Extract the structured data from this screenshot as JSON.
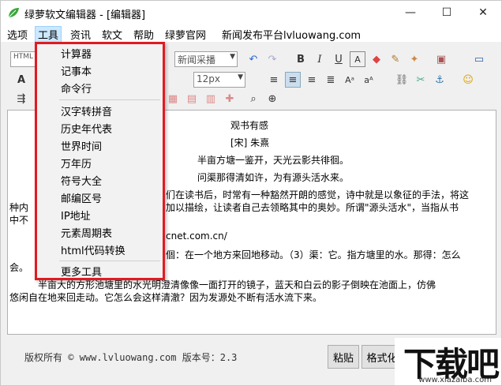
{
  "window": {
    "title": "绿萝软文编辑器 - [编辑器]",
    "controls": {
      "minimize": "—",
      "maximize": "☐",
      "close": "✕"
    }
  },
  "menubar": [
    "选项",
    "工具",
    "资讯",
    "软文",
    "帮助",
    "绿萝官网",
    "新闻发布平台lvluowang.com"
  ],
  "toolbar": {
    "format_select": "HTML",
    "font_select": "新闻采播",
    "size_select": "12px"
  },
  "tools_menu": {
    "group1": [
      "计算器",
      "记事本",
      "命令行"
    ],
    "group2": [
      "汉字转拼音",
      "历史年代表",
      "世界时间",
      "万年历",
      "符号大全",
      "邮编区号",
      "IP地址",
      "元素周期表",
      "html代码转换"
    ],
    "group3": [
      "更多工具"
    ]
  },
  "editor": {
    "title": "观书有感",
    "author": "[宋] 朱熹",
    "verse1": "半亩方塘一鉴开，天光云影共徘徊。",
    "verse2": "问渠那得清如许，为有源头活水来。",
    "para1_a": "们在读书后，时常有一种豁然开朗的感觉，诗中就是以象征的手法，将这",
    "para1_b": "种内",
    "para1_c": "加以描绘，让读者自己去领略其中的奥妙。所谓\"源头活水\"，当指从书",
    "para1_d": "中不",
    "link": "cnet.com.cn/",
    "para2_a": "個：在一个地方来回地移动。（3）渠：它。指方塘里的水。那得：怎么",
    "para2_b": "会。",
    "para3_a": "半亩大的方形池塘里的水光明澄清像像一面打开的镜子，蓝天和白云的影子倒映在池面上，仿佛",
    "para3_b": "悠闲自在地来回走动。它怎么会这样清澈？因为发源处不断有活水流下来。"
  },
  "footer": {
    "status": "版权所有 © www.lvluowang.com 版本号：2.3",
    "paste_button": "粘贴",
    "format_button": "格式化"
  },
  "watermark": {
    "main": "下载吧",
    "sub": "www.xiazaiba.com"
  },
  "colors": {
    "dropdown_border": "#e01b22",
    "menu_highlight": "#cce8ff"
  }
}
